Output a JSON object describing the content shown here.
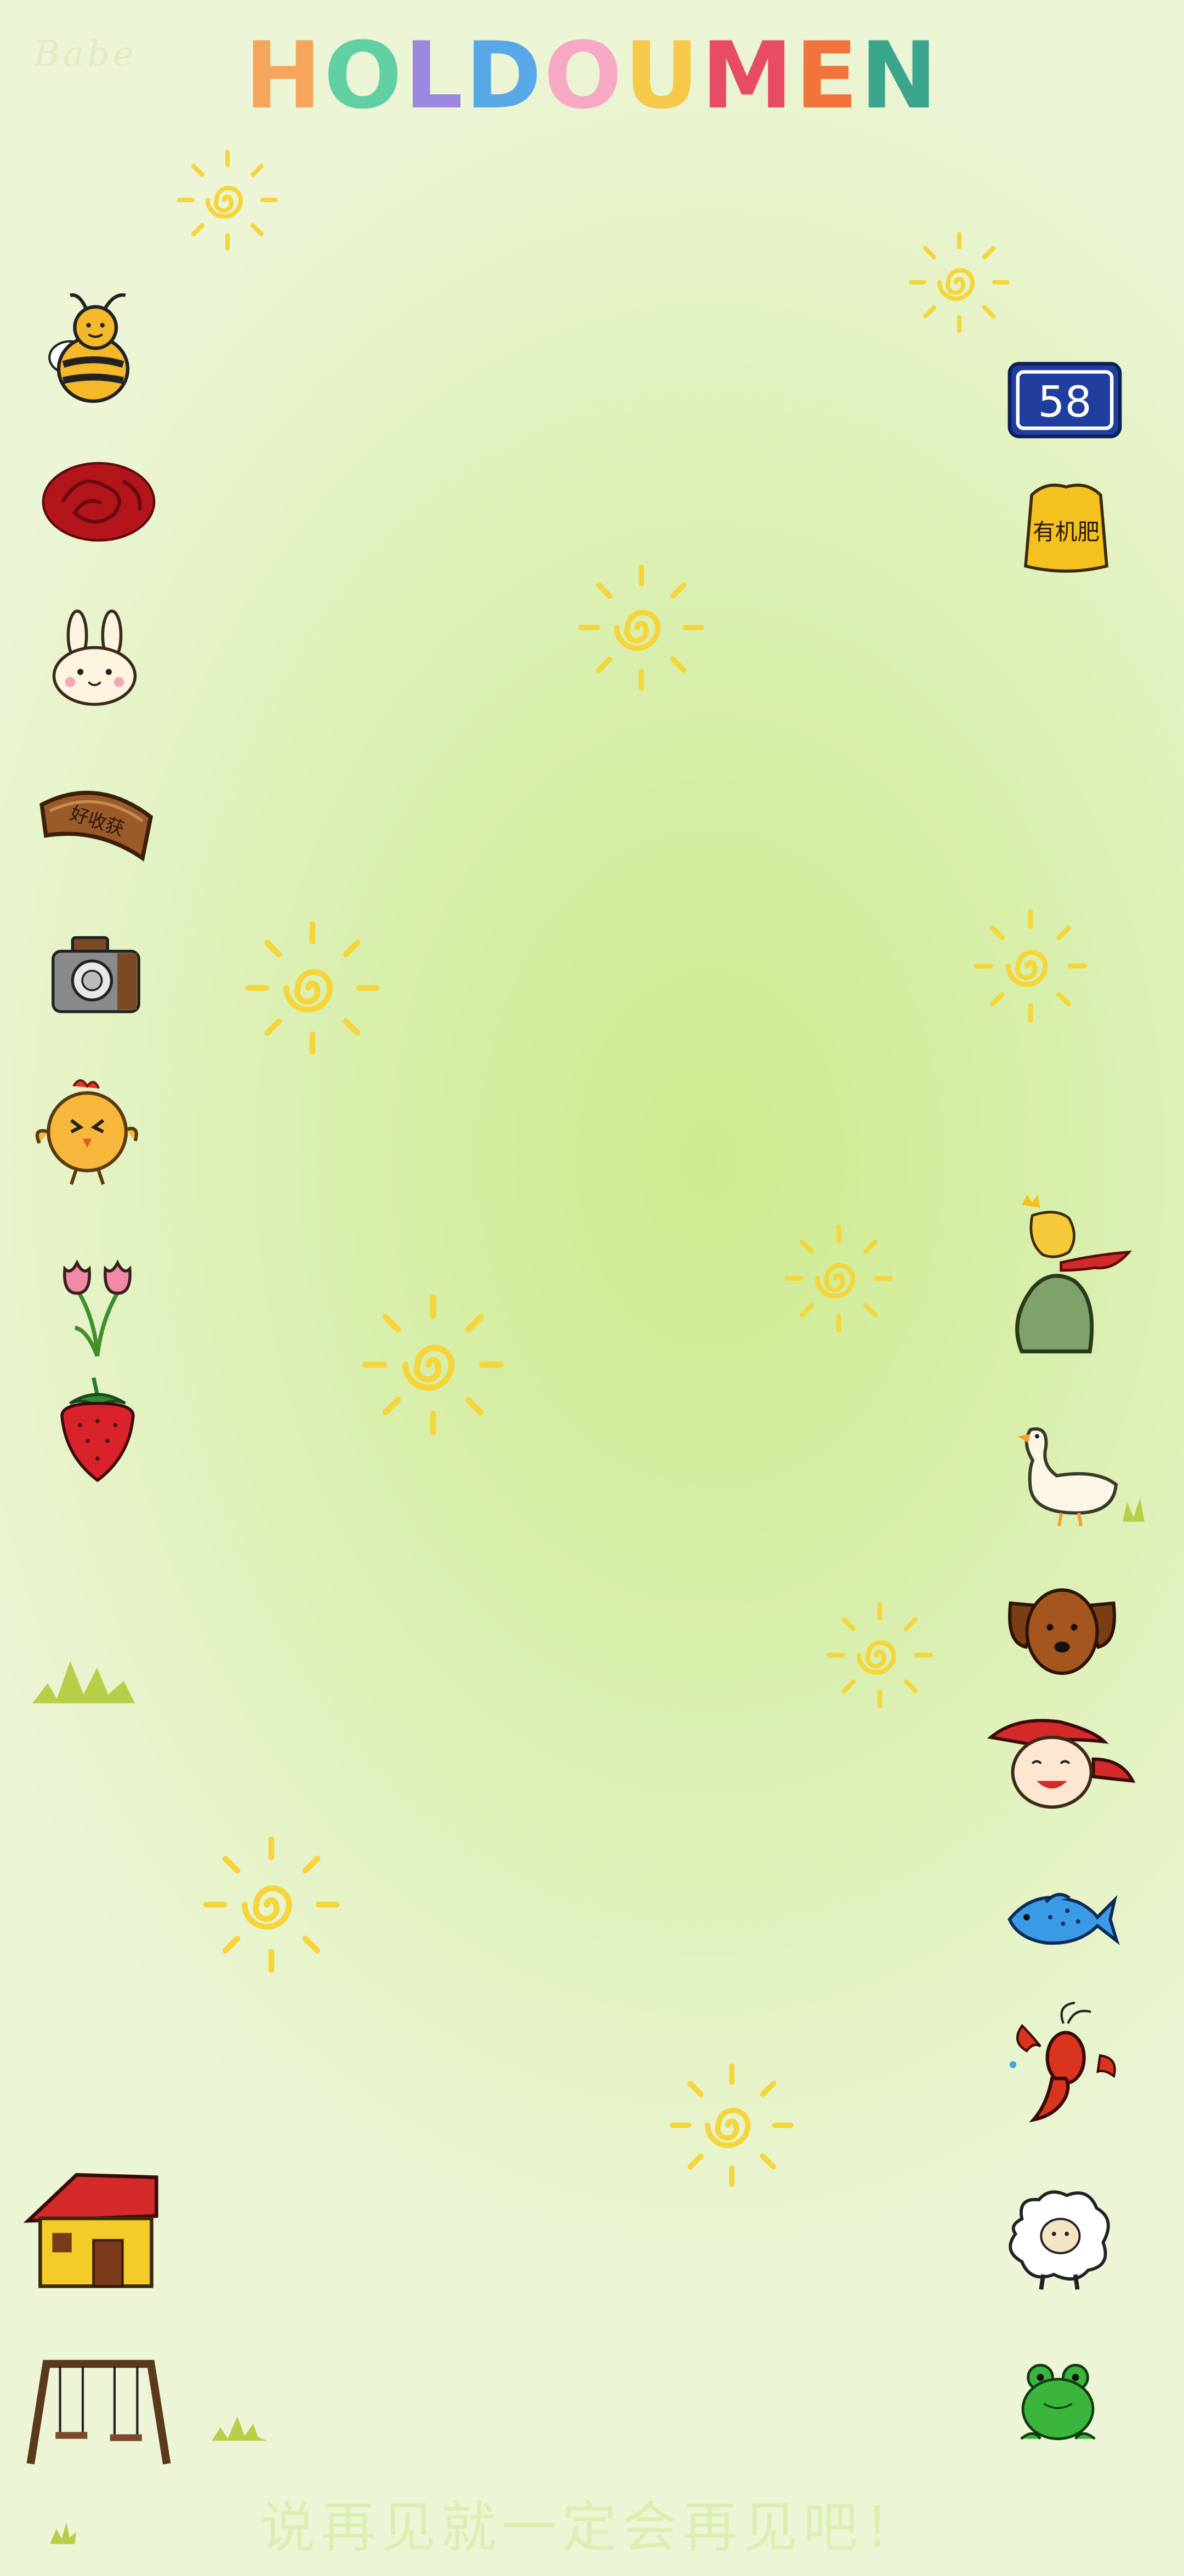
{
  "watermark": "Babe",
  "title": {
    "letters": [
      {
        "ch": "H",
        "color": "#f6a65a"
      },
      {
        "ch": "O",
        "color": "#60cfa4"
      },
      {
        "ch": "L",
        "color": "#9b86e0"
      },
      {
        "ch": "D",
        "color": "#58a8e8"
      },
      {
        "ch": "O",
        "color": "#f7a8c4"
      },
      {
        "ch": "U",
        "color": "#f6c94a"
      },
      {
        "ch": "M",
        "color": "#e84c64"
      },
      {
        "ch": "E",
        "color": "#f0743c"
      },
      {
        "ch": "N",
        "color": "#3aa58c"
      }
    ]
  },
  "badge_number": "58",
  "fertilizer_label": "有机肥",
  "plaque_text": "好收获",
  "footer_text": "说再见就一定会再见吧！",
  "colors": {
    "sun": "#f5d53a",
    "background": "#dff0b8",
    "badge": "#1f3e9e",
    "grass": "#b7cf48"
  },
  "icons_left": [
    "bee-icon",
    "rose-icon",
    "bunny-icon",
    "wood-plaque-icon",
    "camera-icon",
    "chick-icon",
    "tulip-icon",
    "strawberry-icon",
    "grass-tuft-icon",
    "house-icon",
    "swing-icon"
  ],
  "icons_right": [
    "number-badge-icon",
    "fertilizer-bag-icon",
    "little-prince-icon",
    "goose-icon",
    "dog-icon",
    "grandpa-icon",
    "fish-icon",
    "crayfish-icon",
    "sheep-icon",
    "frog-icon"
  ]
}
